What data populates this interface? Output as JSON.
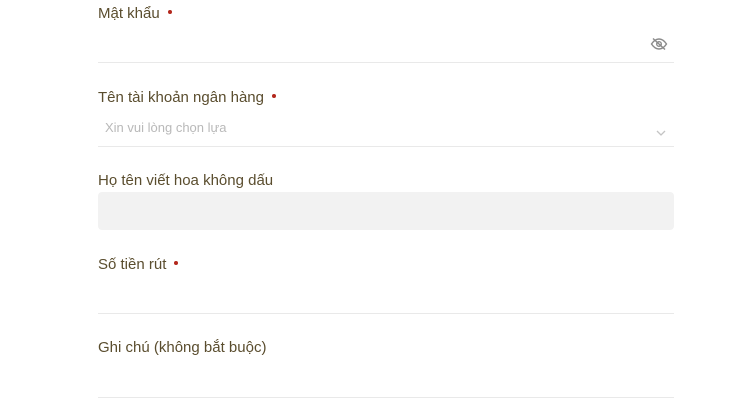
{
  "form": {
    "password": {
      "label": "Mật khẩu",
      "value": "",
      "toggle_icon": "eye-off-icon"
    },
    "bank_account": {
      "label": "Tên tài khoản ngân hàng",
      "placeholder": "Xin vui lòng chọn lựa",
      "dropdown_icon": "chevron-down-icon"
    },
    "full_name": {
      "label": "Họ tên viết hoa không dấu",
      "value": ""
    },
    "amount": {
      "label": "Số tiền rút",
      "value": ""
    },
    "note": {
      "label": "Ghi chú (không bắt buộc)",
      "value": ""
    }
  },
  "colors": {
    "label": "#5a4d2e",
    "required_dot": "#b3271c",
    "divider": "#e9e9e9",
    "disabled_bg": "#f2f2f2",
    "placeholder": "#b9b9b9"
  }
}
